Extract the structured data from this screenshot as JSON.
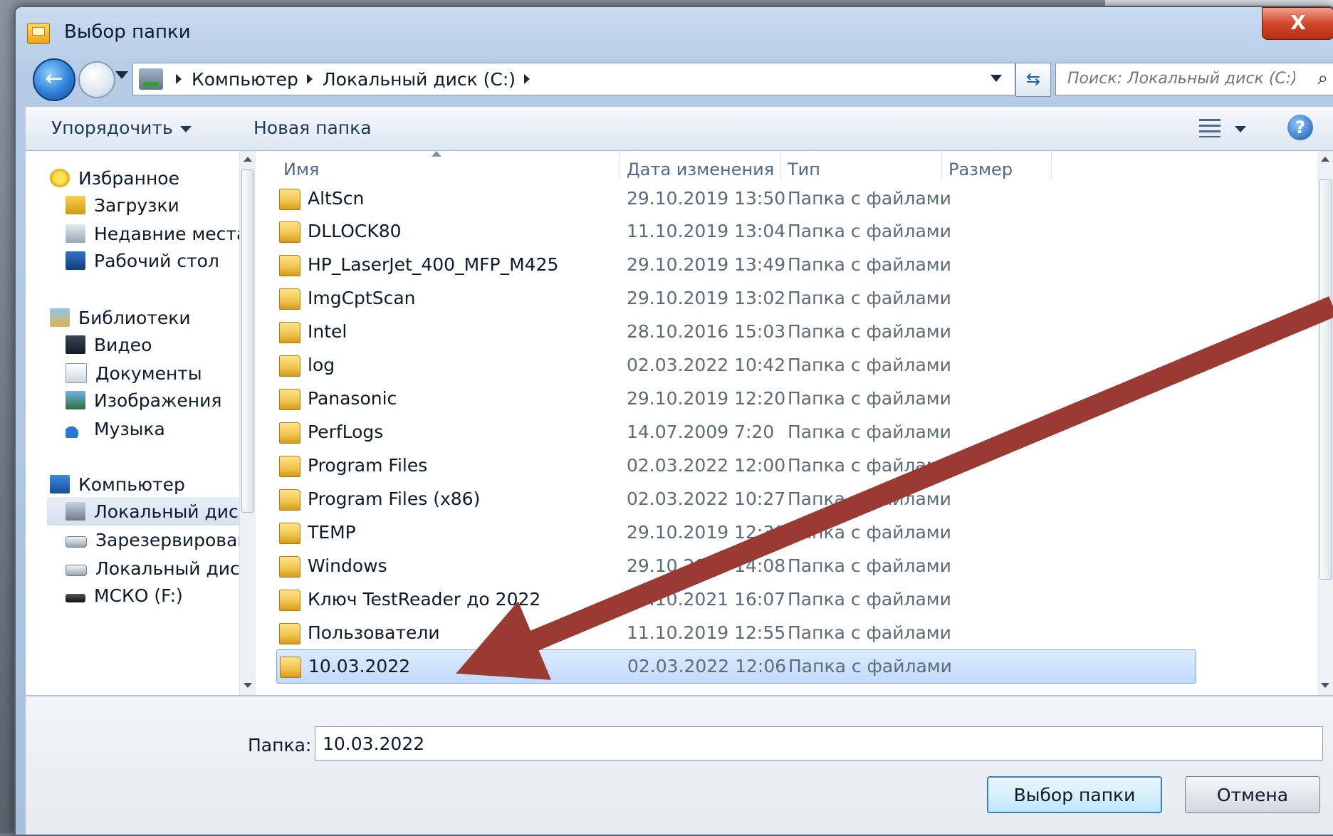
{
  "window": {
    "title": "Выбор папки",
    "close_label": "X"
  },
  "address": {
    "crumbs": [
      "Компьютер",
      "Локальный диск (C:)"
    ],
    "refresh_glyph": "⇆",
    "search_placeholder": "Поиск: Локальный диск (C:)"
  },
  "toolbar": {
    "organize_label": "Упорядочить",
    "new_folder_label": "Новая папка",
    "help_label": "?"
  },
  "nav": {
    "favorites": "Избранное",
    "downloads": "Загрузки",
    "recent": "Недавние места",
    "desktop": "Рабочий стол",
    "libraries": "Библиотеки",
    "video": "Видео",
    "documents": "Документы",
    "images": "Изображения",
    "music": "Музыка",
    "computer": "Компьютер",
    "local_disk_c": "Локальный диск",
    "reserved": "Зарезервирован",
    "local_disk_2": "Локальный диск",
    "mcko": "МСКО (F:)"
  },
  "columns": {
    "name": "Имя",
    "date": "Дата изменения",
    "type": "Тип",
    "size": "Размер"
  },
  "files": [
    {
      "name": "AltScn",
      "date": "29.10.2019 13:50",
      "type": "Папка с файлами"
    },
    {
      "name": "DLLOCK80",
      "date": "11.10.2019 13:04",
      "type": "Папка с файлами"
    },
    {
      "name": "HP_LaserJet_400_MFP_M425",
      "date": "29.10.2019 13:49",
      "type": "Папка с файлами"
    },
    {
      "name": "ImgCptScan",
      "date": "29.10.2019 13:02",
      "type": "Папка с файлами"
    },
    {
      "name": "Intel",
      "date": "28.10.2016 15:03",
      "type": "Папка с файлами"
    },
    {
      "name": "log",
      "date": "02.03.2022 10:42",
      "type": "Папка с файлами"
    },
    {
      "name": "Panasonic",
      "date": "29.10.2019 12:20",
      "type": "Папка с файлами"
    },
    {
      "name": "PerfLogs",
      "date": "14.07.2009 7:20",
      "type": "Папка с файлами"
    },
    {
      "name": "Program Files",
      "date": "02.03.2022 12:00",
      "type": "Папка с файлами"
    },
    {
      "name": "Program Files (x86)",
      "date": "02.03.2022 10:27",
      "type": "Папка с файлами"
    },
    {
      "name": "TEMP",
      "date": "29.10.2019 12:30",
      "type": "Папка с файлами"
    },
    {
      "name": "Windows",
      "date": "29.10.2019 14:08",
      "type": "Папка с файлами"
    },
    {
      "name": "Ключ TestReader до 2022",
      "date": "06.10.2021 16:07",
      "type": "Папка с файлами"
    },
    {
      "name": "Пользователи",
      "date": "11.10.2019 12:55",
      "type": "Папка с файлами"
    },
    {
      "name": "10.03.2022",
      "date": "02.03.2022 12:06",
      "type": "Папка с файлами"
    }
  ],
  "folder_field": {
    "label": "Папка:",
    "value": "10.03.2022"
  },
  "buttons": {
    "select": "Выбор папки",
    "cancel": "Отмена"
  },
  "colors": {
    "arrow": "#9a3a32",
    "selection": "#c1dbfb"
  }
}
